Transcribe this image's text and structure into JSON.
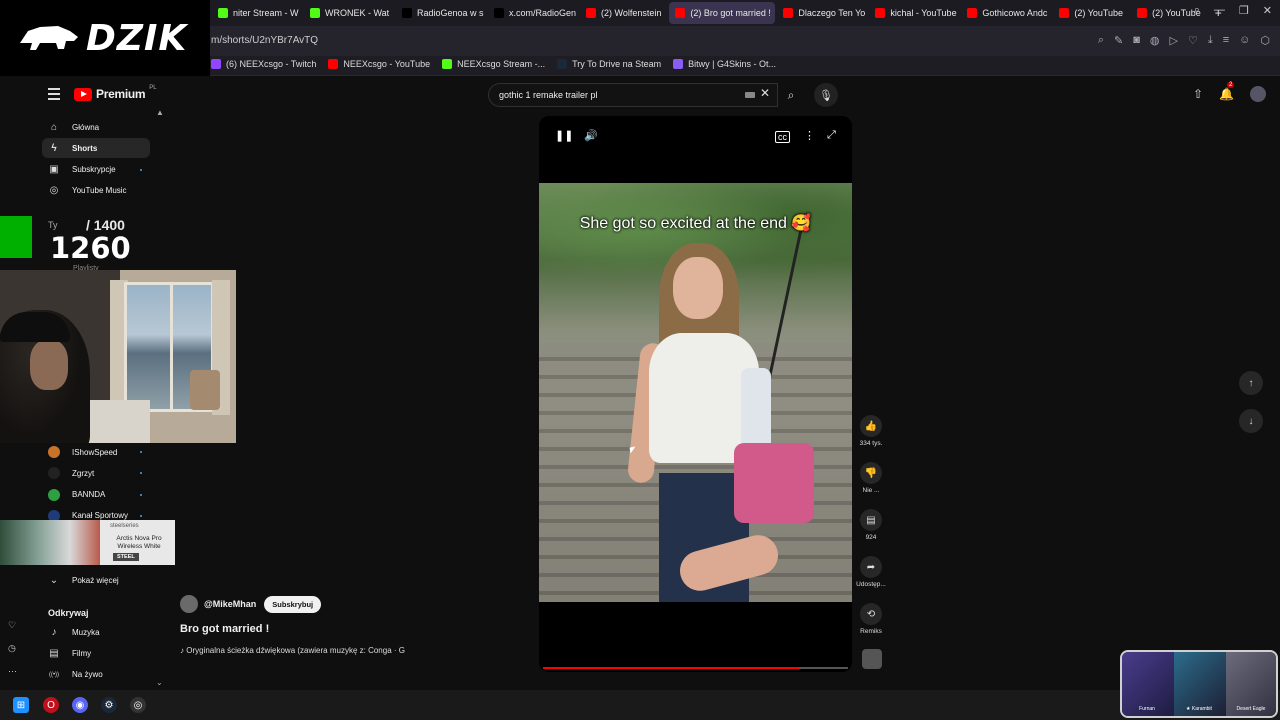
{
  "browser": {
    "tabs": [
      {
        "label": "niter Stream - W",
        "icon_color": "#53fc18",
        "active": false
      },
      {
        "label": "WRONEK - Wat",
        "icon_color": "#53fc18",
        "active": false
      },
      {
        "label": "RadioGenoa w s",
        "icon_color": "#000000",
        "active": false
      },
      {
        "label": "x.com/RadioGen",
        "icon_color": "#000000",
        "active": false
      },
      {
        "label": "(2) Wolfenstein",
        "icon_color": "#ff0000",
        "active": false
      },
      {
        "label": "(2) Bro got married !",
        "icon_color": "#ff0000",
        "active": true
      },
      {
        "label": "Dlaczego Ten Yo",
        "icon_color": "#ff0000",
        "active": false
      },
      {
        "label": "kichal - YouTube",
        "icon_color": "#ff0000",
        "active": false
      },
      {
        "label": "Gothicowo Andc",
        "icon_color": "#ff0000",
        "active": false
      },
      {
        "label": "(2) YouTube",
        "icon_color": "#ff0000",
        "active": false
      },
      {
        "label": "(2) YouTube",
        "icon_color": "#ff0000",
        "active": false
      }
    ],
    "new_tab_label": "+",
    "url": "m/shorts/U2nYBr7AvTQ",
    "bookmarks": [
      {
        "label": "(6) NEEXcsgo - Twitch",
        "icon_color": "#9146ff"
      },
      {
        "label": "NEEXcsgo - YouTube",
        "icon_color": "#ff0000"
      },
      {
        "label": "NEEXcsgo Stream -...",
        "icon_color": "#53fc18"
      },
      {
        "label": "Try To Drive na Steam",
        "icon_color": "#1b2838"
      },
      {
        "label": "Bitwy | G4Skins - Ot...",
        "icon_color": "#8a5cf6"
      }
    ]
  },
  "overlay": {
    "logo_text": "DZIK",
    "score_prefix": "Ty",
    "score_total": "/ 1400",
    "score_current": "1260",
    "ad_brand": "steelseries",
    "ad_product": "Arctis Nova Pro Wireless White",
    "ad_cta": "STEEL"
  },
  "header": {
    "brand": "Premium",
    "country": "PL",
    "search_value": "gothic 1 remake trailer pl",
    "notif_count": "2"
  },
  "sidebar": {
    "items": [
      {
        "label": "Główna",
        "icon": "home-icon"
      },
      {
        "label": "Shorts",
        "icon": "shorts-icon",
        "active": true
      },
      {
        "label": "Subskrypcje",
        "icon": "subscriptions-icon"
      },
      {
        "label": "YouTube Music",
        "icon": "music-icon"
      }
    ],
    "playlist_ghost": "Playlisty",
    "channels": [
      {
        "label": "IShowSpeed",
        "color": "#c8752b"
      },
      {
        "label": "Zgrzyt",
        "color": "#222222"
      },
      {
        "label": "BANNDA",
        "color": "#2ea043"
      },
      {
        "label": "Kanał Sportowy",
        "color": "#1f3b7a"
      }
    ],
    "show_more": "Pokaż więcej",
    "explore_header": "Odkrywaj",
    "explore": [
      {
        "label": "Muzyka",
        "icon": "music-note-icon"
      },
      {
        "label": "Filmy",
        "icon": "film-icon"
      },
      {
        "label": "Na żywo",
        "icon": "live-icon"
      }
    ]
  },
  "video": {
    "caption": "She got so excited at the end 🥰",
    "progress": 0.84
  },
  "actions": {
    "likes": "334 tys.",
    "dislike": "Nie ...",
    "comments": "924",
    "share": "Udostęp...",
    "remix": "Remiks"
  },
  "channel": {
    "handle": "@MikeMhan",
    "subscribe": "Subskrybuj",
    "title": "Bro got married !",
    "audio": "♪ Oryginalna ścieżka dźwiękowa (zawiera muzykę z: Conga · G"
  },
  "stream_thumb": {
    "labels": [
      "Furnan",
      "★ Karambit",
      "Desert Eagle"
    ]
  }
}
